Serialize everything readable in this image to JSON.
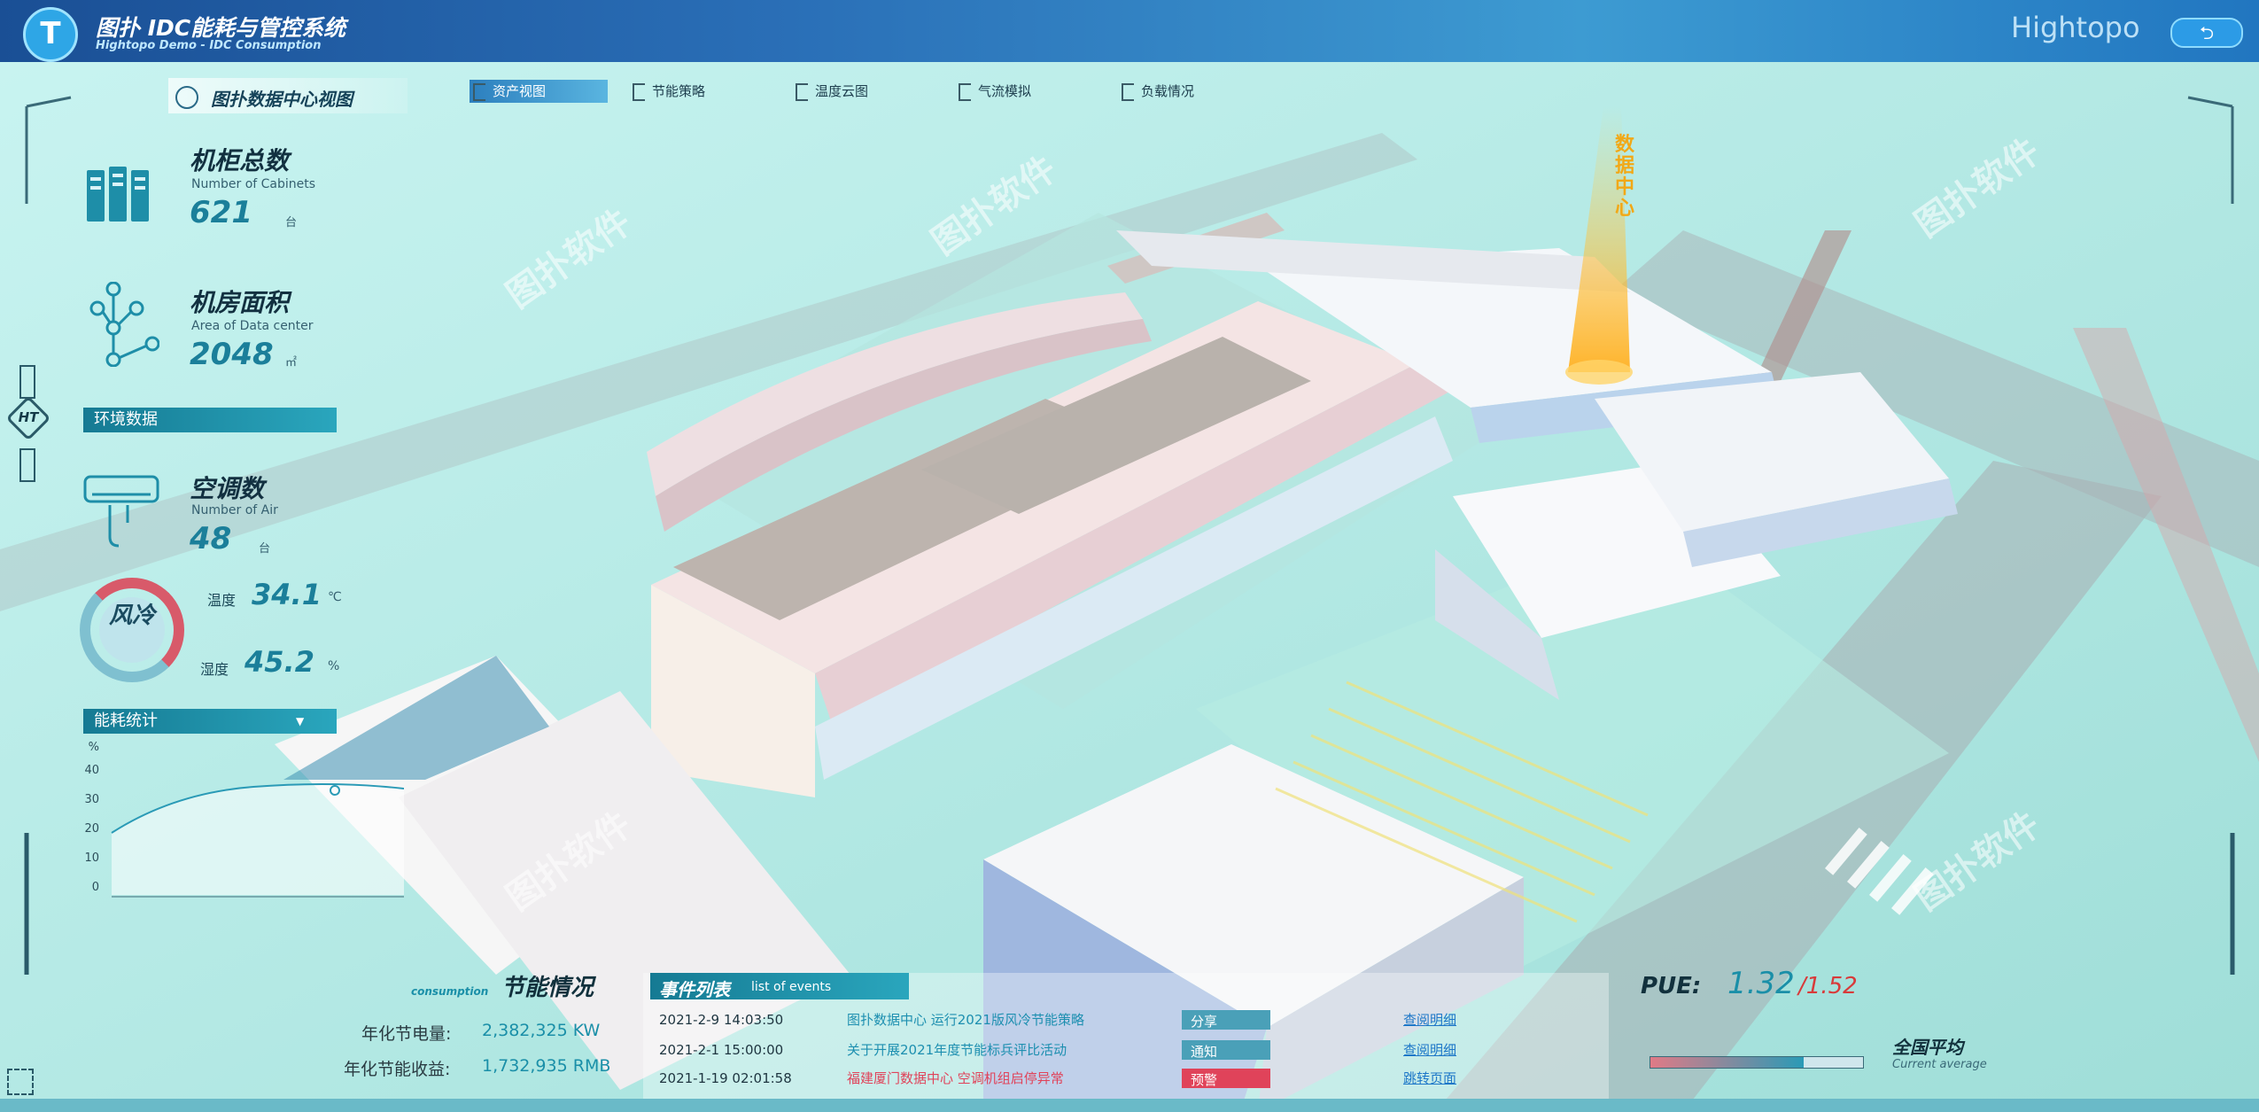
{
  "header": {
    "logo_letter": "T",
    "title": "图扑 IDC能耗与管控系统",
    "subtitle": "Hightopo Demo - IDC Consumption",
    "brand": "Hightopo"
  },
  "nav": {
    "title": "图扑数据中心视图",
    "tabs": [
      {
        "label": "资产视图",
        "active": true
      },
      {
        "label": "节能策略",
        "active": false
      },
      {
        "label": "温度云图",
        "active": false
      },
      {
        "label": "气流模拟",
        "active": false
      },
      {
        "label": "负载情况",
        "active": false
      }
    ]
  },
  "side": {
    "badge": "HT"
  },
  "metrics": {
    "cabinets": {
      "title": "机柜总数",
      "sub": "Number of Cabinets",
      "value": "621",
      "unit": "台"
    },
    "area": {
      "title": "机房面积",
      "sub": "Area of Data center",
      "value": "2048",
      "unit": "㎡"
    },
    "air": {
      "title": "空调数",
      "sub": "Number of Air",
      "value": "48",
      "unit": "台"
    }
  },
  "env": {
    "section_label": "环境数据",
    "mode": "风冷",
    "temp_label": "温度",
    "temp_value": "34.1",
    "temp_unit": "℃",
    "hum_label": "湿度",
    "hum_value": "45.2",
    "hum_unit": "%"
  },
  "energy_chart": {
    "section_label": "能耗统计",
    "dropdown_icon": "▼",
    "y_unit": "%",
    "y_ticks": [
      "40",
      "30",
      "20",
      "10",
      "0"
    ]
  },
  "savings": {
    "title": "节能情况",
    "title_en": "consumption",
    "rows": [
      {
        "label": "年化节电量:",
        "value": "2,382,325 KW"
      },
      {
        "label": "年化节能收益:",
        "value": "1,732,935 RMB"
      }
    ]
  },
  "events": {
    "title": "事件列表",
    "title_en": "list of events",
    "rows": [
      {
        "date": "2021-2-9 14:03:50",
        "text": "图扑数据中心 运行2021版风冷节能策略",
        "type": "分享",
        "link": "查阅明细",
        "color": "#1d8fb0"
      },
      {
        "date": "2021-2-1 15:00:00",
        "text": "关于开展2021年度节能标兵评比活动",
        "type": "通知",
        "link": "查阅明细",
        "color": "#1d8fb0"
      },
      {
        "date": "2021-1-19 02:01:58",
        "text": "福建厦门数据中心 空调机组启停异常",
        "type": "预警",
        "link": "跳转页面",
        "color": "#e0435a"
      }
    ]
  },
  "pue": {
    "label": "PUE:",
    "value": "1.32",
    "avg": "/1.52",
    "avg_label": "全国平均",
    "avg_label_en": "Current average",
    "bar_level": 0.72
  },
  "map": {
    "tower_label": "数据中心"
  },
  "watermark": {
    "text": "图扑软件"
  },
  "colors": {
    "accent": "#1b7f9a",
    "header": "#2a6fb7",
    "alert": "#e0435a"
  }
}
